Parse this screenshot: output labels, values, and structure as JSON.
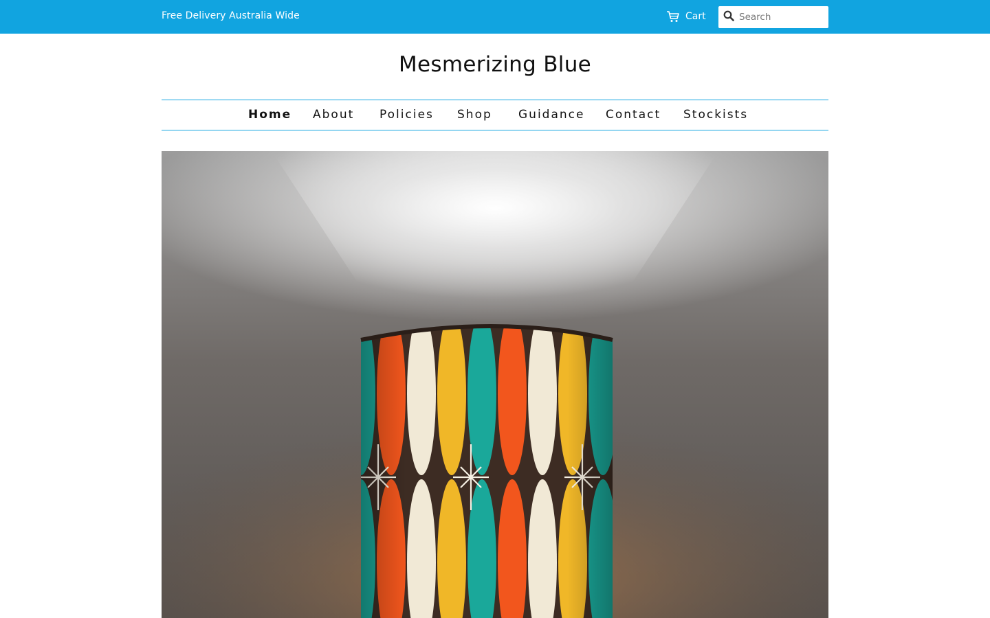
{
  "announcement": "Free Delivery Australia Wide",
  "header": {
    "cart_label": "Cart",
    "search_placeholder": "Search"
  },
  "site_title": "Mesmerizing Blue",
  "nav": {
    "items": [
      {
        "label": "Home",
        "active": true
      },
      {
        "label": "About"
      },
      {
        "label": "Policies"
      },
      {
        "label": "Shop"
      },
      {
        "label": "Guidance"
      },
      {
        "label": "Contact"
      },
      {
        "label": "Stockists"
      }
    ]
  },
  "colors": {
    "accent": "#11a4e0",
    "stripe_teal": "#1aa89a",
    "stripe_orange": "#f2561d",
    "stripe_cream": "#f1e9d6",
    "stripe_mustard": "#f0b728",
    "stripe_brown": "#3d2c23"
  },
  "icons": {
    "cart": "cart-icon",
    "search": "search-icon"
  }
}
